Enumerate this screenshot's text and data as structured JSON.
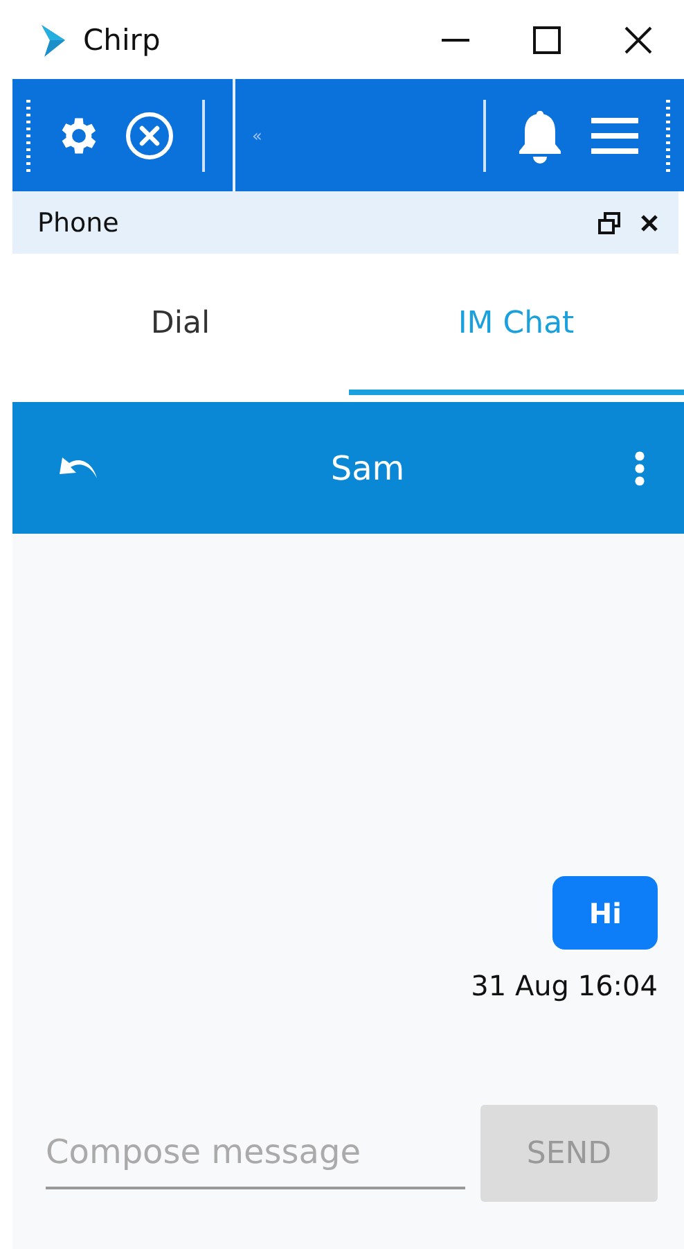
{
  "window": {
    "title": "Chirp"
  },
  "toolbar": {
    "collapse_glyph": "«"
  },
  "panel": {
    "title": "Phone"
  },
  "tabs": [
    {
      "label": "Dial",
      "selected": false
    },
    {
      "label": "IM Chat",
      "selected": true
    }
  ],
  "chat": {
    "contact": "Sam",
    "messages": [
      {
        "text": "Hi",
        "time": "31 Aug 16:04",
        "outgoing": true
      }
    ]
  },
  "compose": {
    "placeholder": "Compose message",
    "send_label": "SEND",
    "send_disabled": true
  }
}
